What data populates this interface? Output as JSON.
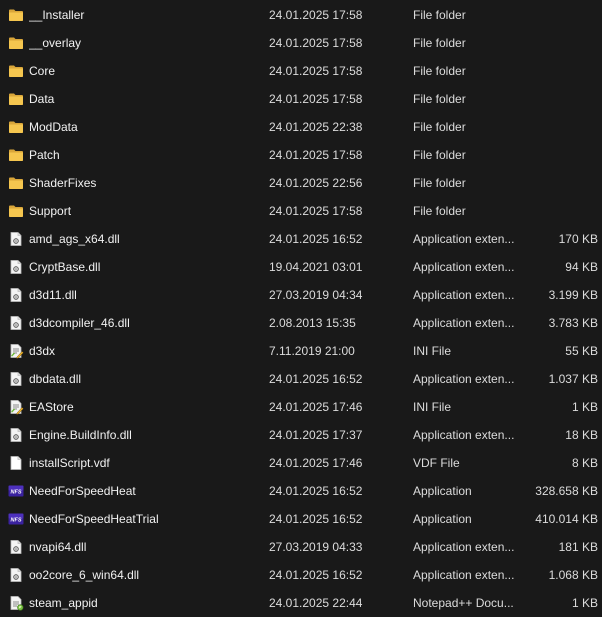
{
  "files": [
    {
      "name": "__Installer",
      "date": "24.01.2025 17:58",
      "type": "File folder",
      "size": "",
      "icon": "folder-icon"
    },
    {
      "name": "__overlay",
      "date": "24.01.2025 17:58",
      "type": "File folder",
      "size": "",
      "icon": "folder-icon"
    },
    {
      "name": "Core",
      "date": "24.01.2025 17:58",
      "type": "File folder",
      "size": "",
      "icon": "folder-icon"
    },
    {
      "name": "Data",
      "date": "24.01.2025 17:58",
      "type": "File folder",
      "size": "",
      "icon": "folder-icon"
    },
    {
      "name": "ModData",
      "date": "24.01.2025 22:38",
      "type": "File folder",
      "size": "",
      "icon": "folder-icon"
    },
    {
      "name": "Patch",
      "date": "24.01.2025 17:58",
      "type": "File folder",
      "size": "",
      "icon": "folder-icon"
    },
    {
      "name": "ShaderFixes",
      "date": "24.01.2025 22:56",
      "type": "File folder",
      "size": "",
      "icon": "folder-icon"
    },
    {
      "name": "Support",
      "date": "24.01.2025 17:58",
      "type": "File folder",
      "size": "",
      "icon": "folder-icon"
    },
    {
      "name": "amd_ags_x64.dll",
      "date": "24.01.2025 16:52",
      "type": "Application exten...",
      "size": "170 KB",
      "icon": "dll-file-icon"
    },
    {
      "name": "CryptBase.dll",
      "date": "19.04.2021 03:01",
      "type": "Application exten...",
      "size": "94 KB",
      "icon": "dll-file-icon"
    },
    {
      "name": "d3d11.dll",
      "date": "27.03.2019 04:34",
      "type": "Application exten...",
      "size": "3.199 KB",
      "icon": "dll-file-icon"
    },
    {
      "name": "d3dcompiler_46.dll",
      "date": "2.08.2013 15:35",
      "type": "Application exten...",
      "size": "3.783 KB",
      "icon": "dll-file-icon"
    },
    {
      "name": "d3dx",
      "date": "7.11.2019 21:00",
      "type": "INI File",
      "size": "55 KB",
      "icon": "ini-file-icon"
    },
    {
      "name": "dbdata.dll",
      "date": "24.01.2025 16:52",
      "type": "Application exten...",
      "size": "1.037 KB",
      "icon": "dll-file-icon"
    },
    {
      "name": "EAStore",
      "date": "24.01.2025 17:46",
      "type": "INI File",
      "size": "1 KB",
      "icon": "ini-file-icon"
    },
    {
      "name": "Engine.BuildInfo.dll",
      "date": "24.01.2025 17:37",
      "type": "Application exten...",
      "size": "18 KB",
      "icon": "dll-file-icon"
    },
    {
      "name": "installScript.vdf",
      "date": "24.01.2025 17:46",
      "type": "VDF File",
      "size": "8 KB",
      "icon": "blank-file-icon"
    },
    {
      "name": "NeedForSpeedHeat",
      "date": "24.01.2025 16:52",
      "type": "Application",
      "size": "328.658 KB",
      "icon": "nfs-app-icon"
    },
    {
      "name": "NeedForSpeedHeatTrial",
      "date": "24.01.2025 16:52",
      "type": "Application",
      "size": "410.014 KB",
      "icon": "nfs-app-icon"
    },
    {
      "name": "nvapi64.dll",
      "date": "27.03.2019 04:33",
      "type": "Application exten...",
      "size": "181 KB",
      "icon": "dll-file-icon"
    },
    {
      "name": "oo2core_6_win64.dll",
      "date": "24.01.2025 16:52",
      "type": "Application exten...",
      "size": "1.068 KB",
      "icon": "dll-file-icon"
    },
    {
      "name": "steam_appid",
      "date": "24.01.2025 22:44",
      "type": "Notepad++ Docu...",
      "size": "1 KB",
      "icon": "notepadpp-file-icon"
    }
  ],
  "colors": {
    "background": "#191919",
    "text": "#ffffff",
    "folder": "#f2c14e",
    "nfs_badge": "#4b2fa8"
  }
}
